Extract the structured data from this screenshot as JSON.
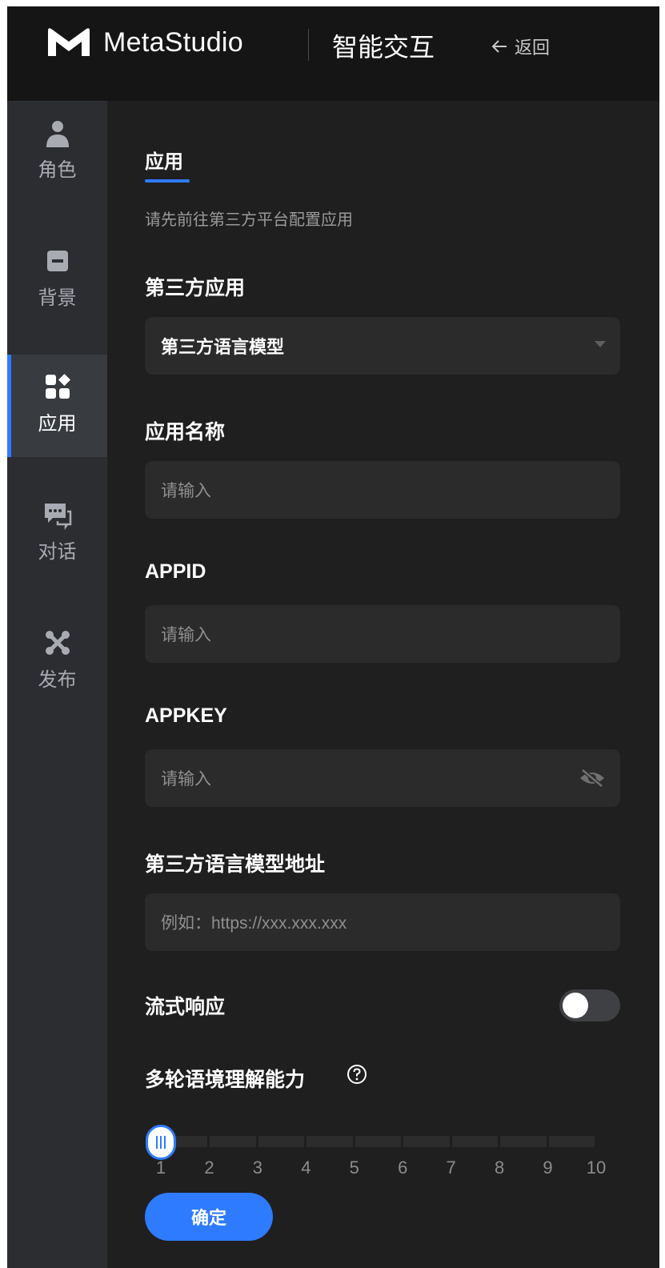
{
  "header": {
    "brand": "MetaStudio",
    "module_title": "智能交互",
    "back_label": "返回"
  },
  "sidebar": {
    "items": [
      {
        "label": "角色",
        "icon": "person-icon",
        "active": false
      },
      {
        "label": "背景",
        "icon": "background-icon",
        "active": false
      },
      {
        "label": "应用",
        "icon": "apps-icon",
        "active": true
      },
      {
        "label": "对话",
        "icon": "chat-icon",
        "active": false
      },
      {
        "label": "发布",
        "icon": "publish-icon",
        "active": false
      }
    ]
  },
  "main": {
    "tab_label": "应用",
    "hint": "请先前往第三方平台配置应用",
    "third_party_app": {
      "label": "第三方应用",
      "selected": "第三方语言模型"
    },
    "app_name": {
      "label": "应用名称",
      "placeholder": "请输入"
    },
    "appid": {
      "label": "APPID",
      "placeholder": "请输入"
    },
    "appkey": {
      "label": "APPKEY",
      "placeholder": "请输入"
    },
    "llm_url": {
      "label": "第三方语言模型地址",
      "placeholder": "例如：https://xxx.xxx.xxx"
    },
    "streaming": {
      "label": "流式响应",
      "enabled": false
    },
    "multi_turn": {
      "label": "多轮语境理解能力",
      "value": 1,
      "ticks": [
        "1",
        "2",
        "3",
        "4",
        "5",
        "6",
        "7",
        "8",
        "9",
        "10"
      ]
    },
    "confirm_label": "确定"
  },
  "colors": {
    "accent": "#2f7bff",
    "background": "#1f1f1f",
    "sidebar": "#2b2d31",
    "input": "#2b2b2b"
  }
}
